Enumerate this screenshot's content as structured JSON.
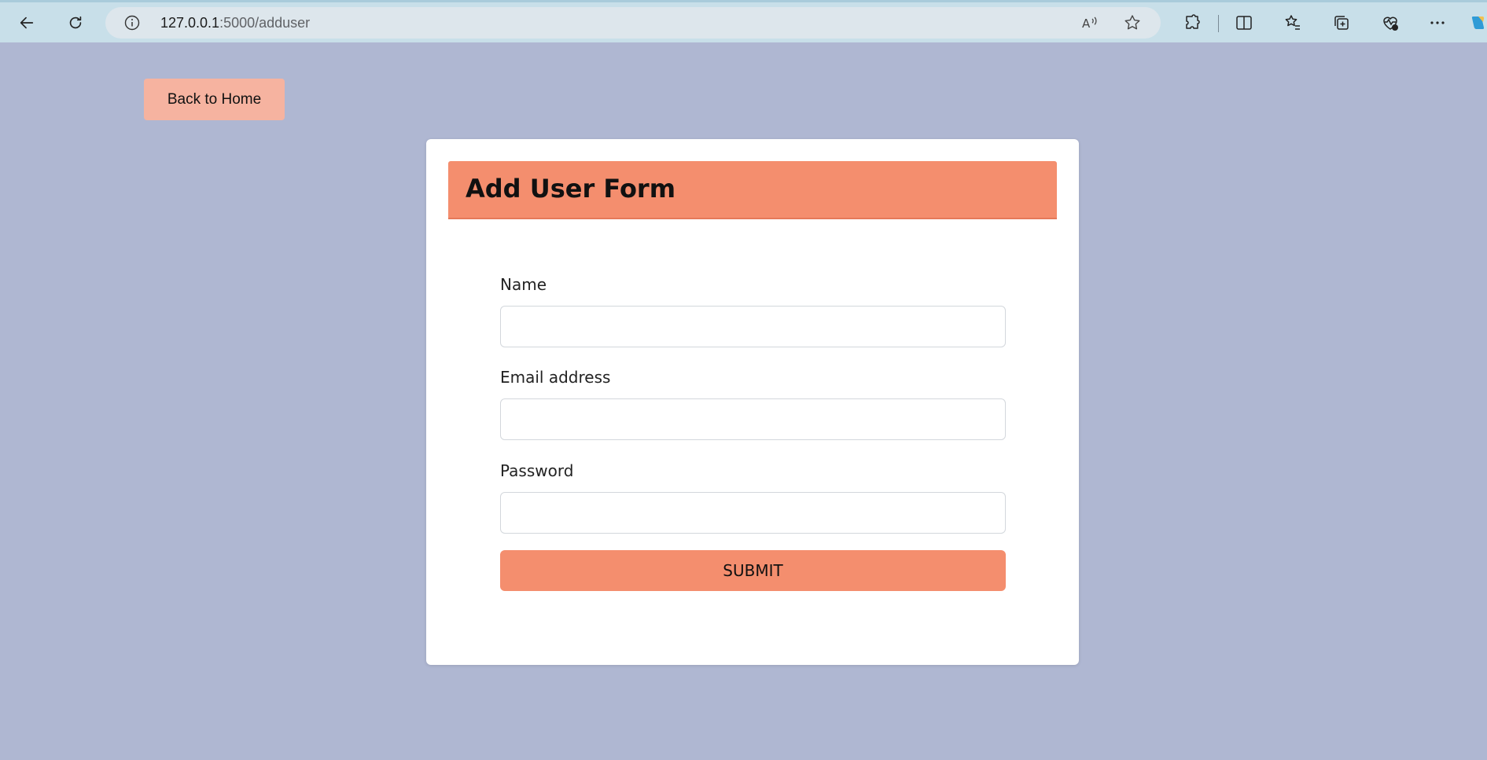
{
  "browser": {
    "url_host": "127.0.0.1",
    "url_path": ":5000/adduser",
    "icons": {
      "back": "back-arrow-icon",
      "refresh": "refresh-icon",
      "info": "info-icon",
      "read_aloud": "read-aloud-icon",
      "favorite": "star-icon",
      "extensions": "puzzle-icon",
      "split_screen": "split-screen-icon",
      "favorites": "favorites-list-icon",
      "collections": "collections-icon",
      "health": "browser-essentials-icon",
      "more": "more-icon",
      "copilot": "copilot-icon"
    }
  },
  "page": {
    "back_label": "Back to Home"
  },
  "form": {
    "title": "Add User Form",
    "name_label": "Name",
    "name_value": "",
    "email_label": "Email address",
    "email_value": "",
    "password_label": "Password",
    "password_value": "",
    "submit_label": "SUBMIT"
  },
  "colors": {
    "page_background": "#afb7d2",
    "accent": "#f48e6e",
    "back_button": "#f6b3a0",
    "card": "#ffffff"
  }
}
